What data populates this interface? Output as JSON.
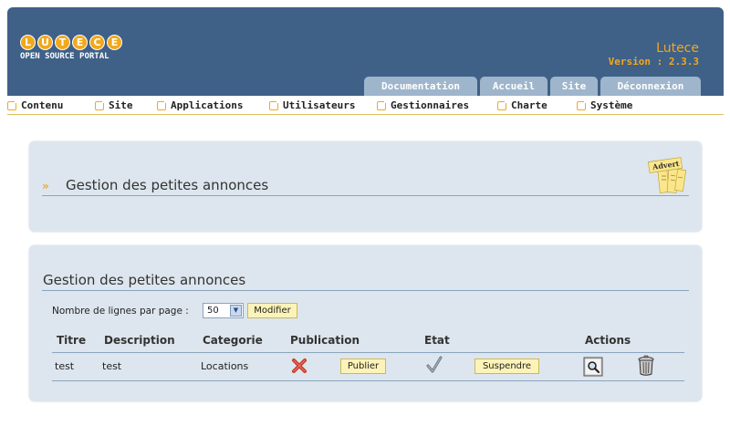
{
  "header": {
    "logo_letters": [
      "L",
      "U",
      "T",
      "E",
      "C",
      "E"
    ],
    "logo_subtitle": "OPEN SOURCE PORTAL",
    "site_name": "Lutece",
    "version": "Version : 2.3.3",
    "tabs": [
      {
        "label": "Documentation"
      },
      {
        "label": "Accueil"
      },
      {
        "label": "Site"
      },
      {
        "label": "Déconnexion"
      }
    ]
  },
  "menu": {
    "items": [
      {
        "label": "Contenu"
      },
      {
        "label": "Site"
      },
      {
        "label": "Applications"
      },
      {
        "label": "Utilisateurs"
      },
      {
        "label": "Gestionnaires"
      },
      {
        "label": "Charte"
      },
      {
        "label": "Système"
      }
    ]
  },
  "panel1": {
    "title": "Gestion des petites annonces",
    "icon": "advert-icon",
    "icon_text": "Advert"
  },
  "panel2": {
    "title": "Gestion des petites annonces",
    "rows_per_page_label": "Nombre de lignes par page :",
    "rows_per_page_value": "50",
    "modify_button": "Modifier",
    "columns": [
      "Titre",
      "Description",
      "Categorie",
      "Publication",
      "Etat",
      "Actions"
    ],
    "rows": [
      {
        "titre": "test",
        "description": "test",
        "categorie": "Locations",
        "publication_icon": "red-cross-icon",
        "publish_button": "Publier",
        "etat_icon": "checkmark-icon",
        "suspend_button": "Suspendre",
        "actions": [
          "view-icon",
          "trash-icon"
        ]
      }
    ]
  },
  "colors": {
    "header_bg": "#3f6087",
    "accent": "#f2a81c",
    "tab_bg": "#9eb5cc",
    "panel_bg": "#dde6ee",
    "button_bg": "#fcf3b8"
  }
}
